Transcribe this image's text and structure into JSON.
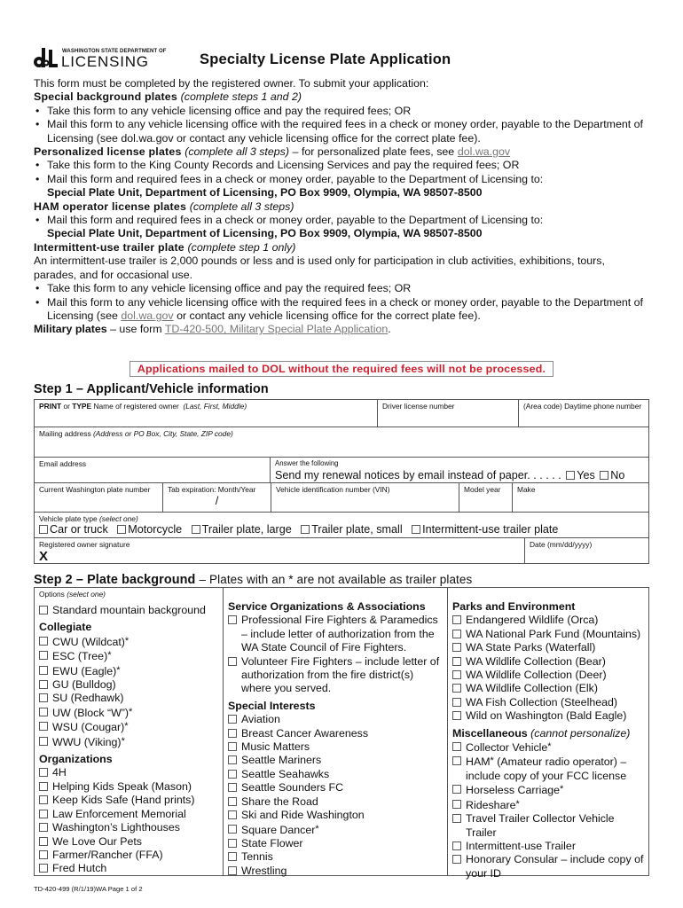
{
  "header": {
    "logo_small": "WASHINGTON STATE DEPARTMENT OF",
    "logo_big": "LICENSING",
    "title": "Specialty License Plate Application"
  },
  "intro": {
    "lead": "This form must be completed by the registered owner. To submit your application:",
    "special_background": {
      "heading": "Special background plates",
      "note": "(complete steps 1 and 2)",
      "bullets": [
        "Take this form to any vehicle licensing office and pay the required fees; OR",
        "Mail this form to any vehicle licensing office with the required fees in a check or money order, payable to the Department of Licensing (see dol.wa.gov or contact any vehicle licensing office for the correct plate fee)."
      ]
    },
    "personalized": {
      "heading": "Personalized license plates",
      "note": "(complete all 3 steps)",
      "after_note": "– for personalized plate fees, see",
      "link": "dol.wa.gov",
      "bullets": [
        "Take this form to the King County Records and Licensing Services and pay the required fees; OR",
        "Mail this form and required fees in a check or money order, payable to the Department of Licensing to:"
      ],
      "address": "Special Plate Unit, Department of Licensing, PO Box 9909, Olympia, WA 98507-8500"
    },
    "ham": {
      "heading": "HAM operator license plates",
      "note": "(complete all 3 steps)",
      "bullets": [
        "Mail this form and required fees in a check or money order, payable to the Department of Licensing to:"
      ],
      "address": "Special Plate Unit, Department of Licensing, PO Box 9909, Olympia, WA 98507-8500"
    },
    "trailer": {
      "heading": "Intermittent-use trailer plate",
      "note": "(complete step 1 only)",
      "description": "An intermittent-use trailer is 2,000 pounds or less and is used only for participation in club activities, exhibitions, tours, parades, and for occasional use.",
      "bullet1": "Take this form to any vehicle licensing office and pay the required fees; OR",
      "bullet2_pre": "Mail this form to any vehicle licensing office with the required fees in a check or money order, payable to the Department of Licensing (see",
      "bullet2_link": "dol.wa.gov",
      "bullet2_post": "or contact any vehicle licensing office for the correct plate fee)."
    },
    "military": {
      "heading": "Military plates",
      "text": "– use form",
      "link": "TD-420-500, Military Special Plate Application",
      "end": "."
    },
    "warning": "Applications mailed to DOL without the required fees will not be processed."
  },
  "step1": {
    "title": "Step 1 – Applicant/Vehicle information",
    "name_label_b1": "PRINT",
    "name_label_or": "or",
    "name_label_b2": "TYPE",
    "name_label": "Name of registered owner",
    "name_hint": "(Last, First, Middle)",
    "dl_label": "Driver license number",
    "phone_label": "(Area code) Daytime phone number",
    "address_label": "Mailing address",
    "address_hint": "(Address or PO Box, City, State, ZIP code)",
    "email_label": "Email address",
    "answer_label": "Answer the following",
    "renewal_question": "Send my renewal notices by email instead of paper. . . . . .",
    "yes": "Yes",
    "no": "No",
    "plate_number_label": "Current Washington plate number",
    "tab_exp_label": "Tab expiration: Month/Year",
    "tab_exp_sep": "/",
    "vin_label": "Vehicle identification number (VIN)",
    "model_year_label": "Model year",
    "make_label": "Make",
    "plate_type_label": "Vehicle plate type",
    "plate_type_hint": "(select one)",
    "plate_types": [
      "Car or truck",
      "Motorcycle",
      "Trailer plate, large",
      "Trailer plate, small",
      "Intermittent-use trailer plate"
    ],
    "signature_label": "Registered owner signature",
    "signature_mark": "X",
    "date_label": "Date (mm/dd/yyyy)"
  },
  "step2": {
    "title": "Step 2 – Plate background",
    "subtitle": "– Plates with an * are not available as trailer plates",
    "options_label": "Options",
    "options_hint": "(select one)",
    "standard": "Standard mountain background",
    "collegiate": {
      "heading": "Collegiate",
      "items": [
        {
          "label": "CWU (Wildcat)",
          "star": true
        },
        {
          "label": "ESC (Tree)",
          "star": true
        },
        {
          "label": "EWU (Eagle)",
          "star": true
        },
        {
          "label": "GU (Bulldog)",
          "star": false
        },
        {
          "label": "SU (Redhawk)",
          "star": false
        },
        {
          "label": "UW  (Block “W”)",
          "star": true
        },
        {
          "label": "WSU  (Cougar)",
          "star": true
        },
        {
          "label": "WWU  (Viking)",
          "star": true
        }
      ]
    },
    "organizations": {
      "heading": "Organizations",
      "items": [
        "4H",
        "Helping Kids Speak (Mason)",
        "Keep Kids Safe (Hand prints)",
        "Law Enforcement Memorial",
        "Washington’s Lighthouses",
        "We Love Our Pets",
        "Farmer/Rancher (FFA)",
        "Fred Hutch"
      ]
    },
    "service": {
      "heading": "Service Organizations & Associations",
      "items": [
        "Professional Fire Fighters & Paramedics – include letter of authorization from the WA State Council of Fire Fighters.",
        "Volunteer Fire Fighters – include letter of authorization from the fire district(s) where you served."
      ]
    },
    "special_interests": {
      "heading": "Special Interests",
      "items": [
        {
          "label": "Aviation",
          "star": false
        },
        {
          "label": "Breast Cancer Awareness",
          "star": false
        },
        {
          "label": "Music Matters",
          "star": false
        },
        {
          "label": "Seattle Mariners",
          "star": false
        },
        {
          "label": "Seattle Seahawks",
          "star": false
        },
        {
          "label": "Seattle Sounders FC",
          "star": false
        },
        {
          "label": "Share the Road",
          "star": false
        },
        {
          "label": "Ski and Ride Washington",
          "star": false
        },
        {
          "label": "Square Dancer",
          "star": true
        },
        {
          "label": "State Flower",
          "star": false
        },
        {
          "label": "Tennis",
          "star": false
        },
        {
          "label": "Wrestling",
          "star": false
        }
      ]
    },
    "parks": {
      "heading": "Parks and Environment",
      "items": [
        "Endangered Wildlife (Orca)",
        "WA National Park Fund (Mountains)",
        "WA State Parks (Waterfall)",
        "WA Wildlife Collection (Bear)",
        "WA Wildlife Collection (Deer)",
        "WA Wildlife Collection (Elk)",
        "WA Fish Collection (Steelhead)",
        "Wild on Washington (Bald Eagle)"
      ]
    },
    "misc": {
      "heading": "Miscellaneous",
      "note": "(cannot personalize)",
      "items": [
        {
          "label": "Collector Vehicle",
          "star": true,
          "after": ""
        },
        {
          "label": "HAM",
          "star": true,
          "after": " (Amateur radio operator) – include copy of your FCC license"
        },
        {
          "label": "Horseless Carriage",
          "star": true,
          "after": ""
        },
        {
          "label": "Rideshare",
          "star": true,
          "after": ""
        },
        {
          "label": "Travel Trailer Collector Vehicle Trailer",
          "star": false,
          "after": ""
        },
        {
          "label": "Intermittent-use Trailer",
          "star": false,
          "after": ""
        },
        {
          "label": "Honorary Consular – include copy of your ID",
          "star": false,
          "after": ""
        }
      ]
    }
  },
  "footer": "TD-420-499 (R/1/19)WA Page 1 of 2",
  "colors": {
    "warning": "#d0202e",
    "link": "#777777",
    "border": "#555555"
  }
}
